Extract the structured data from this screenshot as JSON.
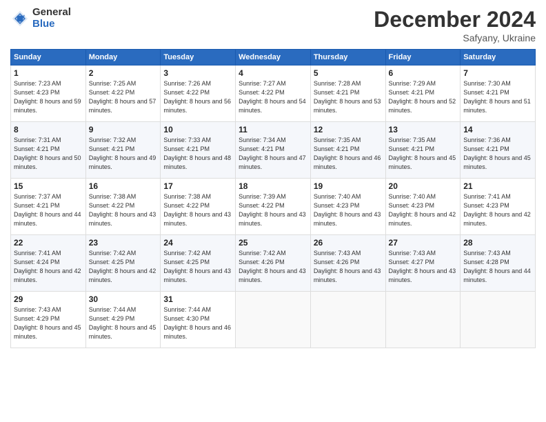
{
  "logo": {
    "general": "General",
    "blue": "Blue"
  },
  "title": "December 2024",
  "location": "Safyany, Ukraine",
  "weekdays": [
    "Sunday",
    "Monday",
    "Tuesday",
    "Wednesday",
    "Thursday",
    "Friday",
    "Saturday"
  ],
  "weeks": [
    [
      {
        "day": "1",
        "sunrise": "7:23 AM",
        "sunset": "4:23 PM",
        "daylight": "8 hours and 59 minutes."
      },
      {
        "day": "2",
        "sunrise": "7:25 AM",
        "sunset": "4:22 PM",
        "daylight": "8 hours and 57 minutes."
      },
      {
        "day": "3",
        "sunrise": "7:26 AM",
        "sunset": "4:22 PM",
        "daylight": "8 hours and 56 minutes."
      },
      {
        "day": "4",
        "sunrise": "7:27 AM",
        "sunset": "4:22 PM",
        "daylight": "8 hours and 54 minutes."
      },
      {
        "day": "5",
        "sunrise": "7:28 AM",
        "sunset": "4:21 PM",
        "daylight": "8 hours and 53 minutes."
      },
      {
        "day": "6",
        "sunrise": "7:29 AM",
        "sunset": "4:21 PM",
        "daylight": "8 hours and 52 minutes."
      },
      {
        "day": "7",
        "sunrise": "7:30 AM",
        "sunset": "4:21 PM",
        "daylight": "8 hours and 51 minutes."
      }
    ],
    [
      {
        "day": "8",
        "sunrise": "7:31 AM",
        "sunset": "4:21 PM",
        "daylight": "8 hours and 50 minutes."
      },
      {
        "day": "9",
        "sunrise": "7:32 AM",
        "sunset": "4:21 PM",
        "daylight": "8 hours and 49 minutes."
      },
      {
        "day": "10",
        "sunrise": "7:33 AM",
        "sunset": "4:21 PM",
        "daylight": "8 hours and 48 minutes."
      },
      {
        "day": "11",
        "sunrise": "7:34 AM",
        "sunset": "4:21 PM",
        "daylight": "8 hours and 47 minutes."
      },
      {
        "day": "12",
        "sunrise": "7:35 AM",
        "sunset": "4:21 PM",
        "daylight": "8 hours and 46 minutes."
      },
      {
        "day": "13",
        "sunrise": "7:35 AM",
        "sunset": "4:21 PM",
        "daylight": "8 hours and 45 minutes."
      },
      {
        "day": "14",
        "sunrise": "7:36 AM",
        "sunset": "4:21 PM",
        "daylight": "8 hours and 45 minutes."
      }
    ],
    [
      {
        "day": "15",
        "sunrise": "7:37 AM",
        "sunset": "4:21 PM",
        "daylight": "8 hours and 44 minutes."
      },
      {
        "day": "16",
        "sunrise": "7:38 AM",
        "sunset": "4:22 PM",
        "daylight": "8 hours and 43 minutes."
      },
      {
        "day": "17",
        "sunrise": "7:38 AM",
        "sunset": "4:22 PM",
        "daylight": "8 hours and 43 minutes."
      },
      {
        "day": "18",
        "sunrise": "7:39 AM",
        "sunset": "4:22 PM",
        "daylight": "8 hours and 43 minutes."
      },
      {
        "day": "19",
        "sunrise": "7:40 AM",
        "sunset": "4:23 PM",
        "daylight": "8 hours and 43 minutes."
      },
      {
        "day": "20",
        "sunrise": "7:40 AM",
        "sunset": "4:23 PM",
        "daylight": "8 hours and 42 minutes."
      },
      {
        "day": "21",
        "sunrise": "7:41 AM",
        "sunset": "4:23 PM",
        "daylight": "8 hours and 42 minutes."
      }
    ],
    [
      {
        "day": "22",
        "sunrise": "7:41 AM",
        "sunset": "4:24 PM",
        "daylight": "8 hours and 42 minutes."
      },
      {
        "day": "23",
        "sunrise": "7:42 AM",
        "sunset": "4:25 PM",
        "daylight": "8 hours and 42 minutes."
      },
      {
        "day": "24",
        "sunrise": "7:42 AM",
        "sunset": "4:25 PM",
        "daylight": "8 hours and 43 minutes."
      },
      {
        "day": "25",
        "sunrise": "7:42 AM",
        "sunset": "4:26 PM",
        "daylight": "8 hours and 43 minutes."
      },
      {
        "day": "26",
        "sunrise": "7:43 AM",
        "sunset": "4:26 PM",
        "daylight": "8 hours and 43 minutes."
      },
      {
        "day": "27",
        "sunrise": "7:43 AM",
        "sunset": "4:27 PM",
        "daylight": "8 hours and 43 minutes."
      },
      {
        "day": "28",
        "sunrise": "7:43 AM",
        "sunset": "4:28 PM",
        "daylight": "8 hours and 44 minutes."
      }
    ],
    [
      {
        "day": "29",
        "sunrise": "7:43 AM",
        "sunset": "4:29 PM",
        "daylight": "8 hours and 45 minutes."
      },
      {
        "day": "30",
        "sunrise": "7:44 AM",
        "sunset": "4:29 PM",
        "daylight": "8 hours and 45 minutes."
      },
      {
        "day": "31",
        "sunrise": "7:44 AM",
        "sunset": "4:30 PM",
        "daylight": "8 hours and 46 minutes."
      },
      null,
      null,
      null,
      null
    ]
  ]
}
